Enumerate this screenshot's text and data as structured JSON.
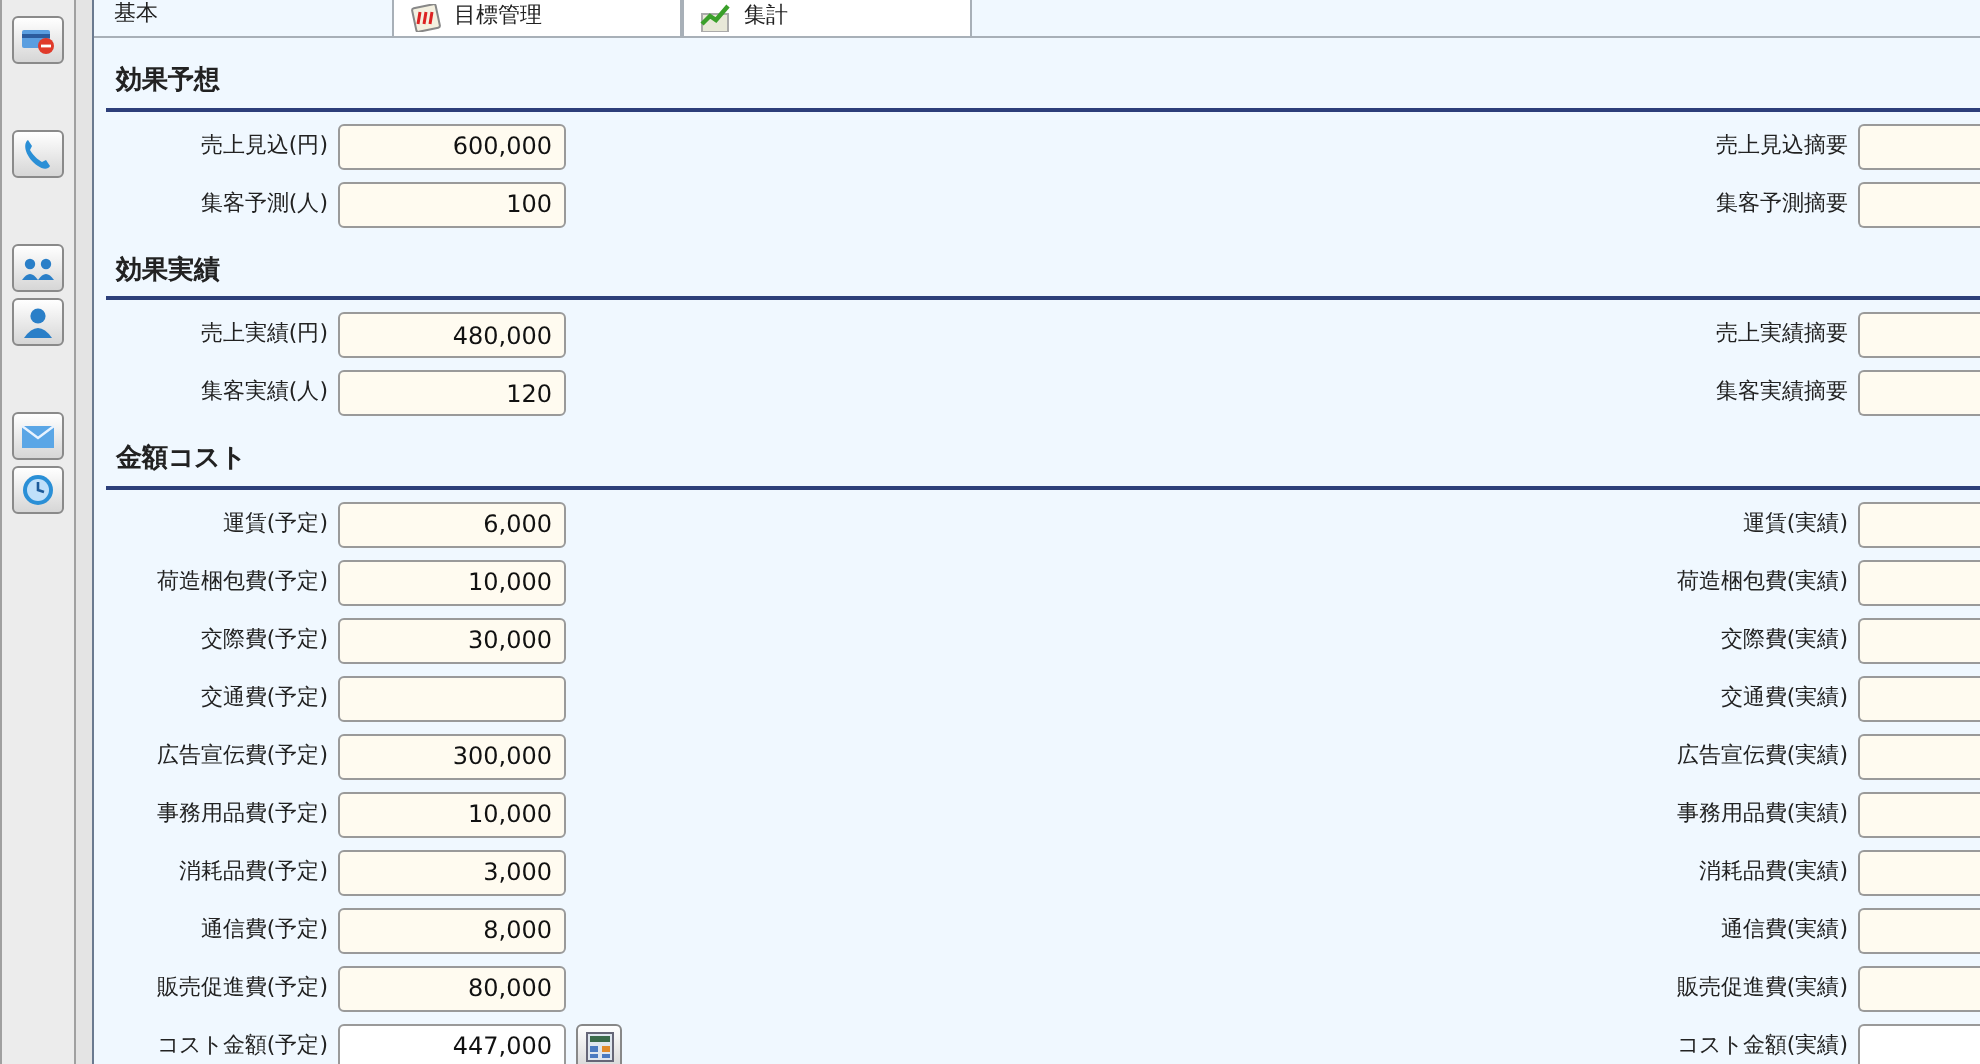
{
  "tabs": [
    {
      "label": "基本",
      "selected": true
    },
    {
      "label": "目標管理",
      "selected": false
    },
    {
      "label": "集計",
      "selected": false
    }
  ],
  "sections": [
    {
      "title": "効果予想",
      "rows": [
        {
          "left": {
            "label": "売上見込(円)",
            "value": "600,000",
            "kind": "input"
          },
          "right": {
            "label": "売上見込摘要"
          }
        },
        {
          "left": {
            "label": "集客予測(人)",
            "value": "100",
            "kind": "input"
          },
          "right": {
            "label": "集客予測摘要"
          }
        }
      ]
    },
    {
      "title": "効果実績",
      "rows": [
        {
          "left": {
            "label": "売上実績(円)",
            "value": "480,000",
            "kind": "input"
          },
          "right": {
            "label": "売上実績摘要"
          }
        },
        {
          "left": {
            "label": "集客実績(人)",
            "value": "120",
            "kind": "input"
          },
          "right": {
            "label": "集客実績摘要"
          }
        }
      ]
    },
    {
      "title": "金額コスト",
      "rows": [
        {
          "left": {
            "label": "運賃(予定)",
            "value": "6,000",
            "kind": "input"
          },
          "right": {
            "label": "運賃(実績)"
          }
        },
        {
          "left": {
            "label": "荷造梱包費(予定)",
            "value": "10,000",
            "kind": "input"
          },
          "right": {
            "label": "荷造梱包費(実績)"
          }
        },
        {
          "left": {
            "label": "交際費(予定)",
            "value": "30,000",
            "kind": "input"
          },
          "right": {
            "label": "交際費(実績)"
          }
        },
        {
          "left": {
            "label": "交通費(予定)",
            "kind": "input"
          },
          "right": {
            "label": "交通費(実績)"
          }
        },
        {
          "left": {
            "label": "広告宣伝費(予定)",
            "value": "300,000",
            "kind": "input"
          },
          "right": {
            "label": "広告宣伝費(実績)"
          }
        },
        {
          "left": {
            "label": "事務用品費(予定)",
            "value": "10,000",
            "kind": "input"
          },
          "right": {
            "label": "事務用品費(実績)"
          }
        },
        {
          "left": {
            "label": "消耗品費(予定)",
            "value": "3,000",
            "kind": "input"
          },
          "right": {
            "label": "消耗品費(実績)"
          }
        },
        {
          "left": {
            "label": "通信費(予定)",
            "value": "8,000",
            "kind": "input"
          },
          "right": {
            "label": "通信費(実績)"
          }
        },
        {
          "left": {
            "label": "販売促進費(予定)",
            "value": "80,000",
            "kind": "input"
          },
          "right": {
            "label": "販売促進費(実績)"
          }
        },
        {
          "left": {
            "label": "コスト金額(予定)",
            "value": "447,000",
            "kind": "computed"
          },
          "right": {
            "label": "コスト金額(実績)",
            "kind": "computed"
          }
        }
      ]
    }
  ]
}
